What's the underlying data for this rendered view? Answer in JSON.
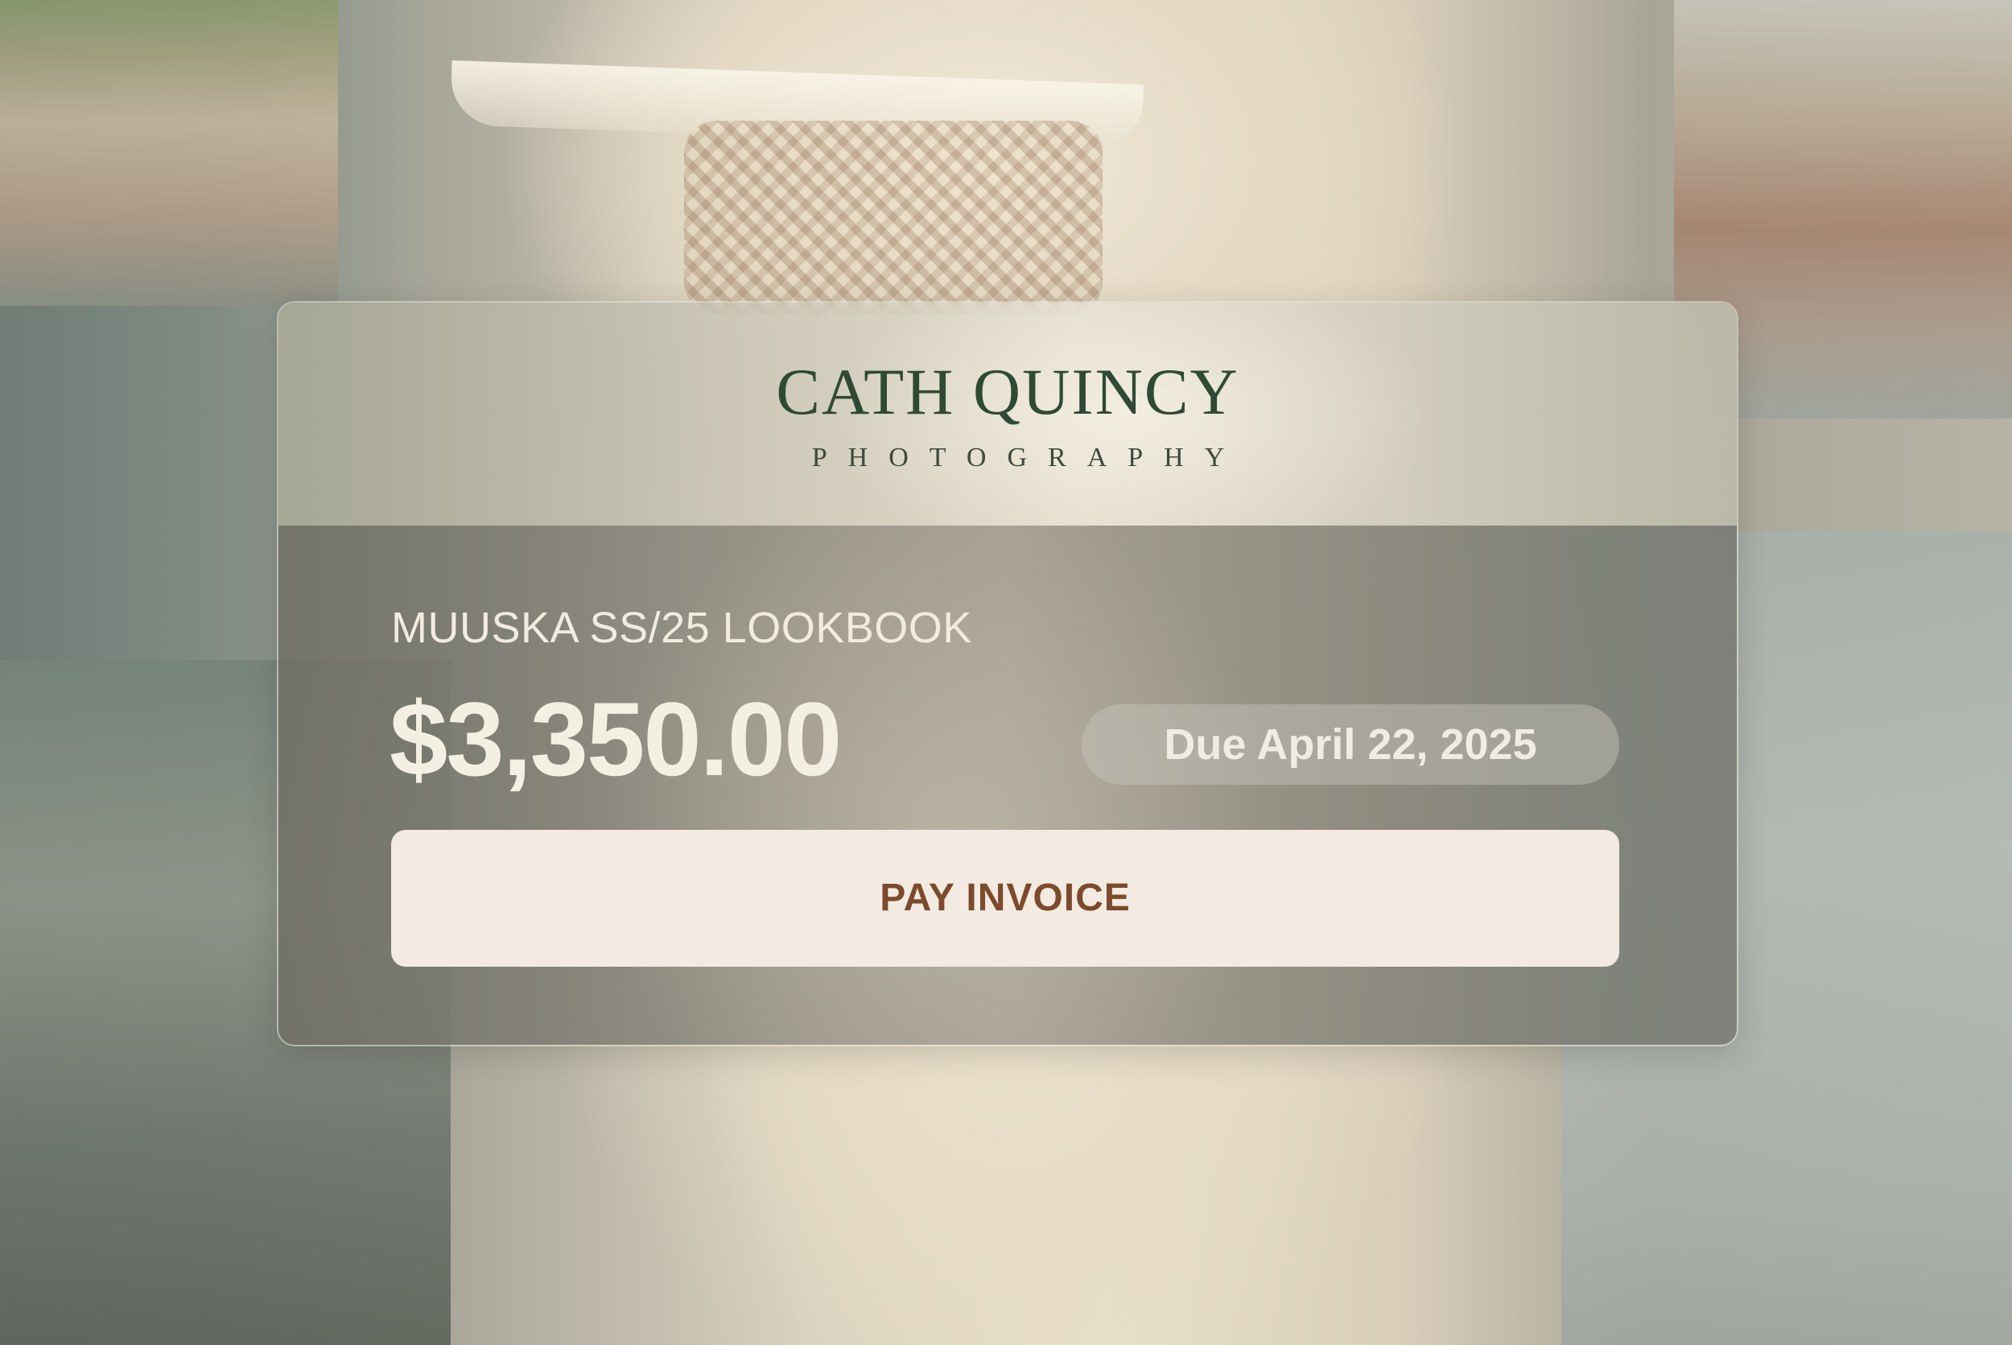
{
  "brand": {
    "name": "CATH QUINCY",
    "tagline": "PHOTOGRAPHY"
  },
  "invoice": {
    "project_title": "MUUSKA SS/25 LOOKBOOK",
    "amount": "$3,350.00",
    "due_label": "Due April 22, 2025",
    "pay_button_label": "PAY INVOICE"
  },
  "colors": {
    "brand_text": "#2f4a34",
    "button_background": "#f3ebe2",
    "button_text": "#7c4a2c",
    "body_text": "#f4efe3"
  }
}
